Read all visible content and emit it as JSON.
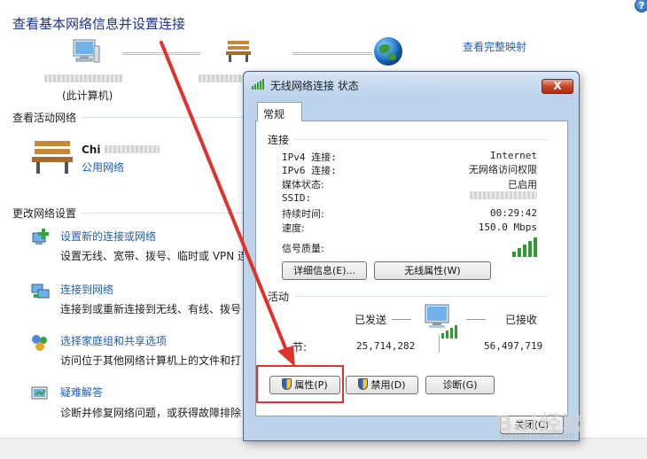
{
  "page": {
    "title": "查看基本网络信息并设置连接",
    "map_link": "查看完整映射",
    "this_pc_label": "(此计算机)"
  },
  "active_networks": {
    "heading": "查看活动网络",
    "network_name": "Chi",
    "network_type": "公用网络"
  },
  "settings": {
    "heading": "更改网络设置",
    "tasks": [
      {
        "link": "设置新的连接或网络",
        "desc": "设置无线、宽带、拨号、临时或 VPN 连",
        "icon": "new-connection-icon"
      },
      {
        "link": "连接到网络",
        "desc": "连接到或重新连接到无线、有线、拨号",
        "icon": "connect-network-icon"
      },
      {
        "link": "选择家庭组和共享选项",
        "desc": "访问位于其他网络计算机上的文件和打",
        "icon": "homegroup-icon"
      },
      {
        "link": "疑难解答",
        "desc": "诊断并修复网络问题，或获得故障排除",
        "icon": "troubleshoot-icon"
      }
    ]
  },
  "dialog": {
    "title": "无线网络连接 状态",
    "close_label": "X",
    "tab": "常规",
    "connection": {
      "heading": "连接",
      "rows": [
        {
          "label": "IPv4 连接:",
          "value": "Internet"
        },
        {
          "label": "IPv6 连接:",
          "value": "无网络访问权限"
        },
        {
          "label": "媒体状态:",
          "value": "已启用"
        },
        {
          "label": "SSID:",
          "value": ""
        },
        {
          "label": "持续时间:",
          "value": "00:29:42"
        },
        {
          "label": "速度:",
          "value": "150.0 Mbps"
        }
      ],
      "signal_label": "信号质量:",
      "signal_bars": 5,
      "details_button": "详细信息(E)...",
      "wireless_props_button": "无线属性(W)"
    },
    "activity": {
      "heading": "活动",
      "sent_label": "已发送",
      "received_label": "已接收",
      "bytes_label": "节:",
      "bytes_sent": "25,714,282",
      "bytes_received": "56,497,719"
    },
    "buttons": {
      "properties": "属性(P)",
      "disable": "禁用(D)",
      "diagnose": "诊断(G)",
      "close": "关闭(C)"
    }
  },
  "colors": {
    "link": "#1f5cb8",
    "highlight": "#e0312a",
    "dialog_frame": "#bcd3ec"
  },
  "watermark": {
    "main": "Bai经验",
    "sub": "jingyan.baidu.com"
  }
}
